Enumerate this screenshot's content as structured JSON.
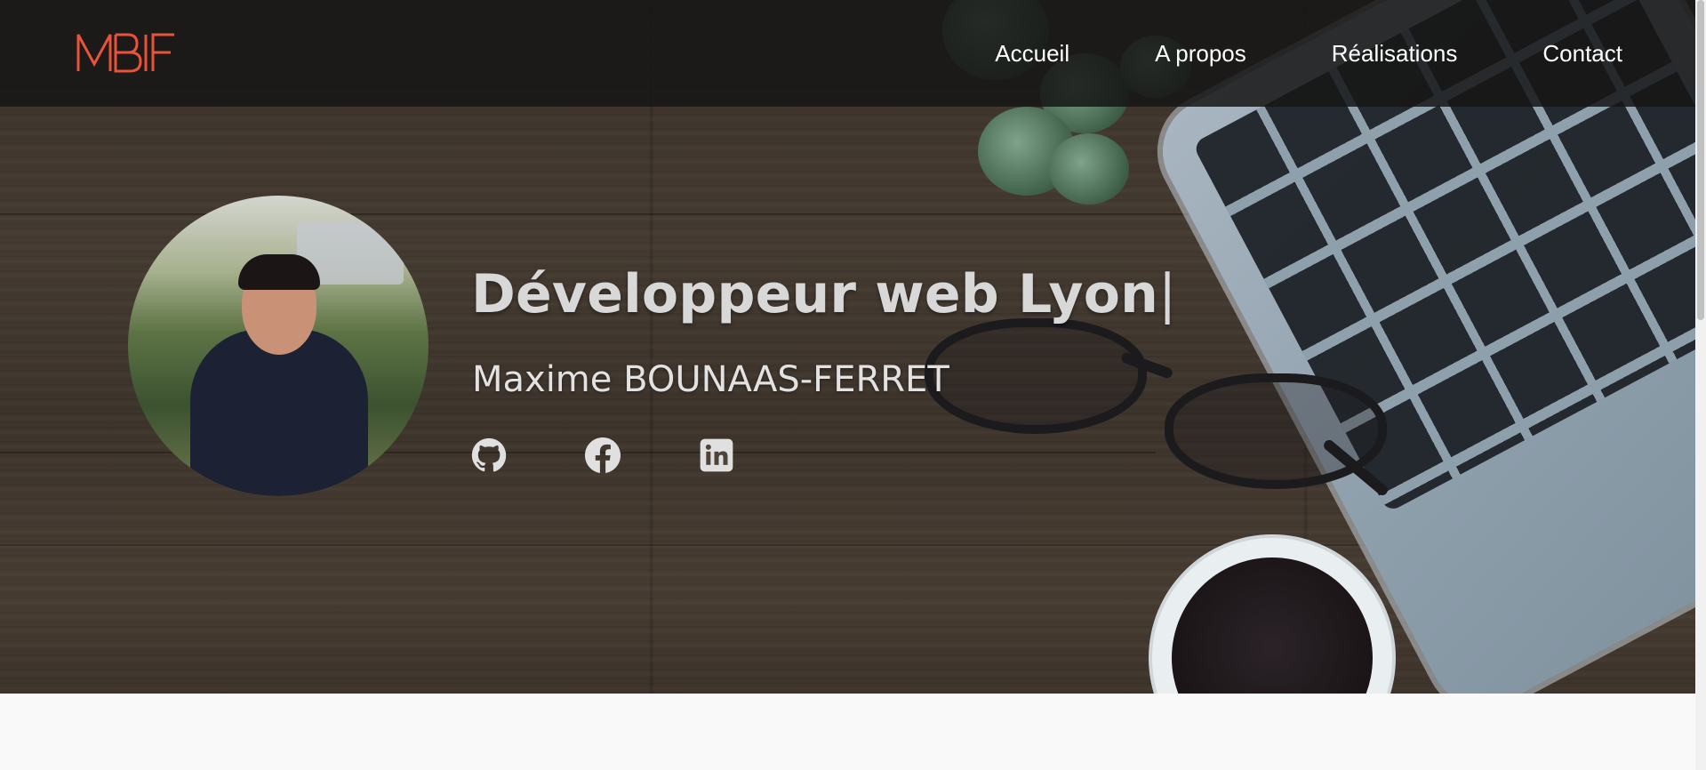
{
  "brand": {
    "logo_text": "MBF",
    "accent": "#e8533a"
  },
  "nav": {
    "items": [
      {
        "label": "Accueil"
      },
      {
        "label": "A propos"
      },
      {
        "label": "Réalisations"
      },
      {
        "label": "Contact"
      }
    ]
  },
  "hero": {
    "title": "Développeur web Lyon",
    "cursor": "|",
    "subtitle": "Maxime BOUNAAS-FERRET",
    "socials": [
      {
        "icon": "github-icon"
      },
      {
        "icon": "facebook-icon"
      },
      {
        "icon": "linkedin-icon"
      }
    ]
  },
  "colors": {
    "navbar_bg": "#161616",
    "text": "#ffffff",
    "page_bg": "#f9f9f9"
  }
}
